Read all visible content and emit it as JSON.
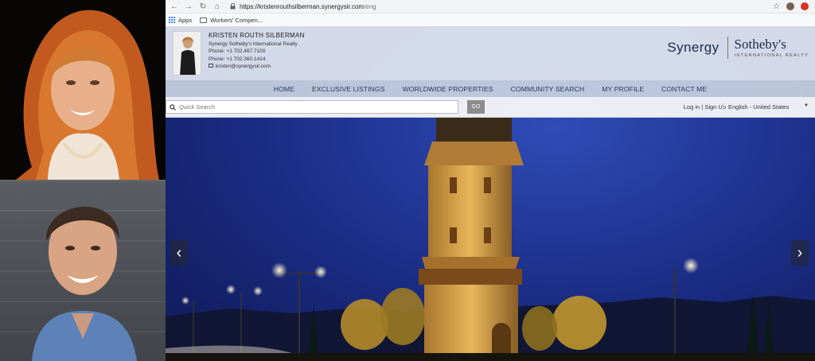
{
  "browser": {
    "url_host": "https://kristenrouthsilberman.synergysir.com",
    "url_path": "/eng",
    "bookmarks": [
      "Apps",
      "Workers' Compen..."
    ]
  },
  "agent": {
    "name": "KRISTEN ROUTH SILBERMAN",
    "company": "Synergy Sotheby's International Realty",
    "phone1": "Phone: +1 702.467.7100",
    "phone2": "Phone: +1 702.360.1414",
    "email": "kristen@synergysir.com"
  },
  "brand": {
    "synergy": "Synergy",
    "sothebys": "Sotheby's",
    "sub": "INTERNATIONAL REALTY"
  },
  "nav": [
    "HOME",
    "EXCLUSIVE LISTINGS",
    "WORLDWIDE PROPERTIES",
    "COMMUNITY SEARCH",
    "MY PROFILE",
    "CONTACT ME"
  ],
  "search": {
    "placeholder": "Quick Search",
    "go_label": "GO",
    "login": "Log in",
    "signup": "Sign Up",
    "language": "English - United States"
  },
  "colors": {
    "sky": "#1a2b82",
    "tower_light": "#e8b75a",
    "nav_text": "#2a3a5a"
  }
}
